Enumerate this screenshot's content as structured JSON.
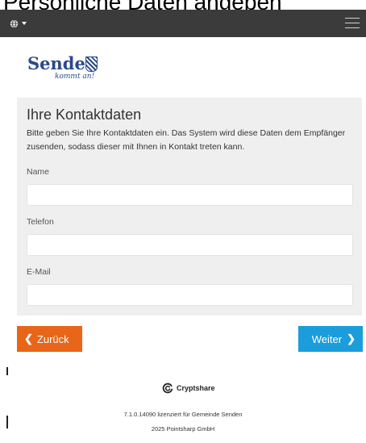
{
  "page": {
    "heading": "Persönliche Daten angeben"
  },
  "header": {
    "language_icon": "globe-icon",
    "menu_icon": "hamburger-menu-icon"
  },
  "brand": {
    "name": "Senden",
    "slogan": "kommt an!",
    "color": "#2a4a8a"
  },
  "form": {
    "title": "Ihre Kontaktdaten",
    "description": "Bitte geben Sie Ihre Kontaktdaten ein. Das System wird diese Daten dem Empfänger zusenden, sodass dieser mit Ihnen in Kontakt treten kann.",
    "fields": [
      {
        "label": "Name",
        "value": ""
      },
      {
        "label": "Telefon",
        "value": ""
      },
      {
        "label": "E-Mail",
        "value": ""
      }
    ]
  },
  "actions": {
    "back_label": "Zurück",
    "next_label": "Weiter",
    "back_color": "#e8661a",
    "next_color": "#1b9ddb"
  },
  "footer": {
    "product": "Cryptshare",
    "license": "7.1.0.14090 lizenziert für Gemeinde Senden",
    "copyright": "2025 Pointsharp GmbH"
  }
}
